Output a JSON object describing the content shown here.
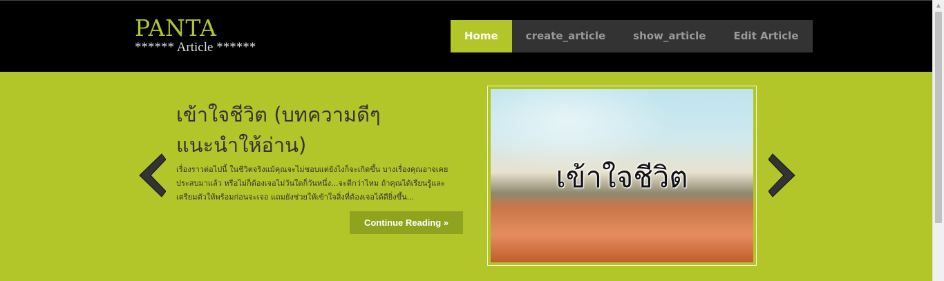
{
  "site": {
    "logo_title": "PANTA",
    "logo_subtitle": "****** Article ******"
  },
  "nav": {
    "items": [
      {
        "label": "Home",
        "active": true
      },
      {
        "label": "create_article",
        "active": false
      },
      {
        "label": "show_article",
        "active": false
      },
      {
        "label": "Edit Article",
        "active": false
      }
    ]
  },
  "slide": {
    "title_line1": "เข้าใจชีวิต (บทความดีๆ",
    "title_line2": "แนะนำให้อ่าน)",
    "excerpt_line1": "เรื่องราวต่อไปนี้ ในชีวิตจริงแม้คุณจะไม่ชอบแต่ยังไงก็จะเกิดขึ้น บางเรื่องคุณอาจเคย",
    "excerpt_line2": "ประสบมาแล้ว หรือไม่ก็ต้องเจอไม่วันใดก็วันหนึ่ง...จะดีกว่าไหม ถ้าคุณได้เรียนรู้และ",
    "excerpt_line3": "เตรียมตัวให้พร้อมก่อนจะเจอ แถมยังช่วยให้เข้าใจสิ่งที่ต้องเจอได้ดียิ่งขึ้น...",
    "button_label": "Continue Reading »",
    "image_caption": "เข้าใจชีวิต"
  },
  "colors": {
    "accent": "#b3c629",
    "header_bg": "#000000",
    "nav_bg": "#333333",
    "button_bg": "#90a31e"
  }
}
